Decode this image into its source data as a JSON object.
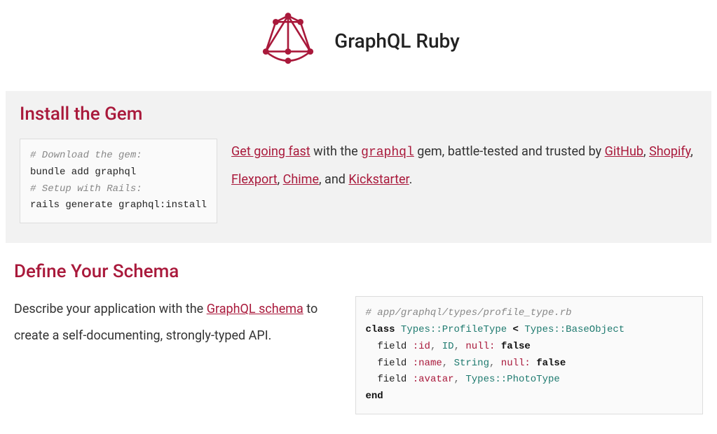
{
  "header": {
    "title": "GraphQL Ruby"
  },
  "install": {
    "heading": "Install the Gem",
    "code": {
      "comment1": "# Download the gem:",
      "line1": "bundle add graphql",
      "comment2": "# Setup with Rails:",
      "line2": "rails generate graphql:install"
    },
    "desc": {
      "getgoing": "Get going fast",
      "t1": " with the ",
      "graphql": "graphql",
      "t2": " gem, battle-tested and trusted by ",
      "github": "GitHub",
      "t3": ", ",
      "shopify": "Shopify",
      "t4": ", ",
      "flexport": "Flexport",
      "t5": ", ",
      "chime": "Chime",
      "t6": ", and ",
      "kickstarter": "Kickstarter",
      "t7": "."
    }
  },
  "schema": {
    "heading": "Define Your Schema",
    "desc": {
      "t1": "Describe your application with the ",
      "link": "GraphQL schema",
      "t2": " to create a self-documenting, strongly-typed API."
    },
    "code": {
      "comment": "# app/graphql/types/profile_type.rb",
      "kw_class": "class",
      "type1": "Types::ProfileType",
      "lt": " < ",
      "type2": "Types::BaseObject",
      "kw_field1": "field",
      "sym_id": ":id",
      "id_type": "ID",
      "null_kw1": "null:",
      "false1": "false",
      "kw_field2": "field",
      "sym_name": ":name",
      "string_type": "String",
      "null_kw2": "null:",
      "false2": "false",
      "kw_field3": "field",
      "sym_avatar": ":avatar",
      "photo_type": "Types::PhotoType",
      "kw_end": "end",
      "comma": ", ",
      "sp": " "
    }
  }
}
